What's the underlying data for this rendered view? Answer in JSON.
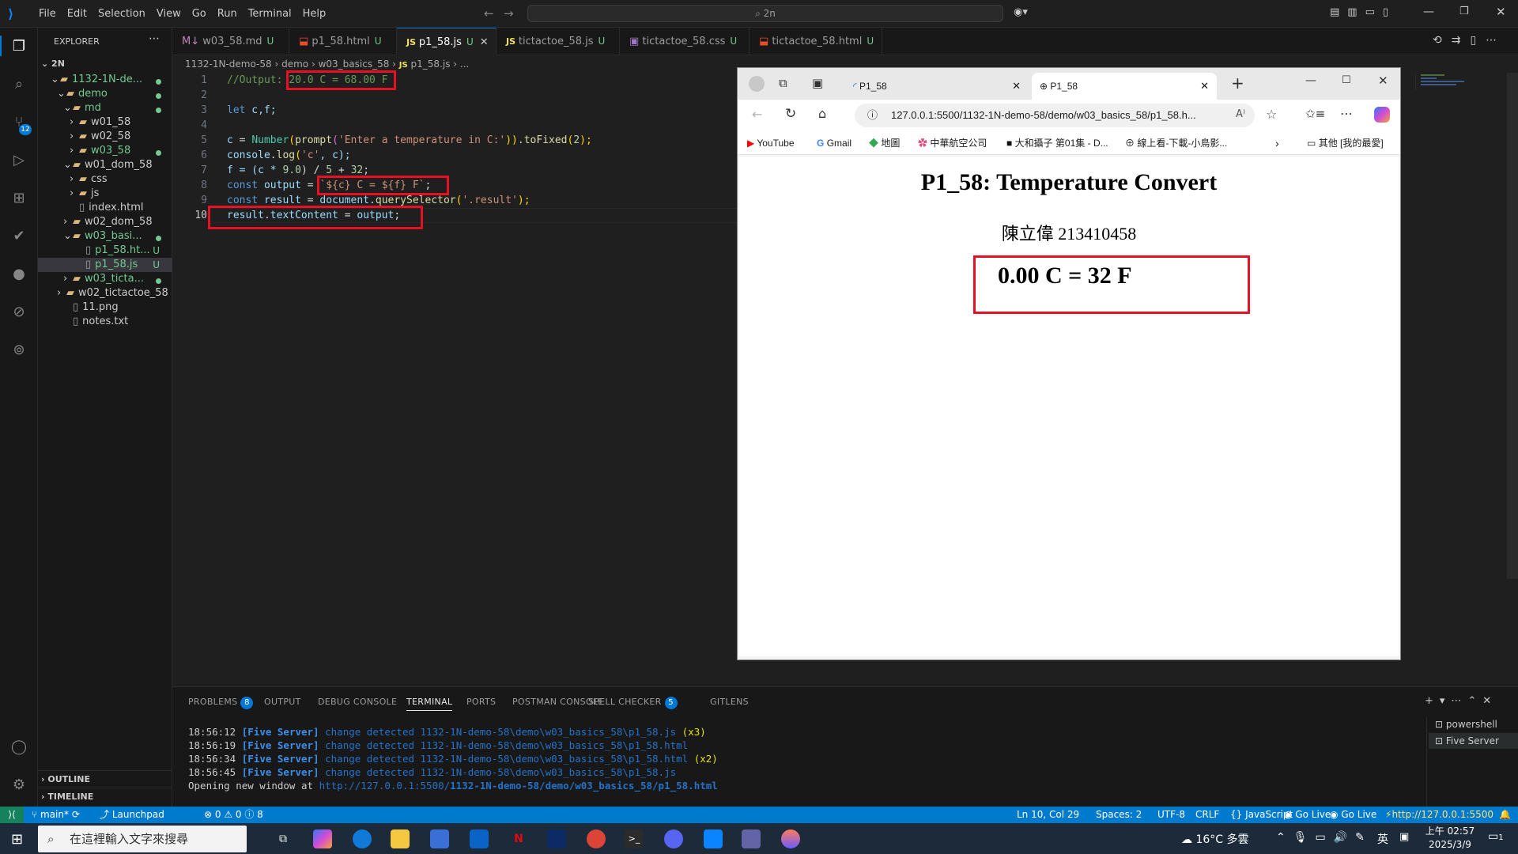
{
  "titlebar": {
    "menu": [
      "File",
      "Edit",
      "Selection",
      "View",
      "Go",
      "Run",
      "Terminal",
      "Help"
    ],
    "search": "2n"
  },
  "explorer": {
    "header": "EXPLORER",
    "root": "2N",
    "items": [
      {
        "label": "1132-1N-de...",
        "type": "folder",
        "mod": "dot"
      },
      {
        "label": "demo",
        "type": "folder",
        "mod": "dot"
      },
      {
        "label": "md",
        "type": "folder",
        "mod": "dot"
      },
      {
        "label": "w01_58",
        "type": "folder",
        "mod": ""
      },
      {
        "label": "w02_58",
        "type": "folder",
        "mod": ""
      },
      {
        "label": "w03_58",
        "type": "folder",
        "mod": "dot"
      },
      {
        "label": "w01_dom_58",
        "type": "folder",
        "mod": ""
      },
      {
        "label": "css",
        "type": "folder",
        "mod": ""
      },
      {
        "label": "js",
        "type": "folder",
        "mod": ""
      },
      {
        "label": "index.html",
        "type": "file",
        "mod": ""
      },
      {
        "label": "w02_dom_58",
        "type": "folder",
        "mod": ""
      },
      {
        "label": "w03_basi...",
        "type": "folder",
        "mod": "dot"
      },
      {
        "label": "p1_58.ht...",
        "type": "file",
        "mod": "U"
      },
      {
        "label": "p1_58.js",
        "type": "file",
        "mod": "U"
      },
      {
        "label": "w03_ticta...",
        "type": "folder",
        "mod": "dot"
      },
      {
        "label": "w02_tictactoe_58",
        "type": "folder",
        "mod": ""
      },
      {
        "label": "11.png",
        "type": "file",
        "mod": ""
      },
      {
        "label": "notes.txt",
        "type": "file",
        "mod": ""
      }
    ],
    "outline": "OUTLINE",
    "timeline": "TIMELINE"
  },
  "tabs": [
    {
      "label": "w03_58.md",
      "badge": "U"
    },
    {
      "label": "p1_58.html",
      "badge": "U"
    },
    {
      "label": "p1_58.js",
      "badge": "U"
    },
    {
      "label": "tictactoe_58.js",
      "badge": "U"
    },
    {
      "label": "tictactoe_58.css",
      "badge": "U"
    },
    {
      "label": "tictactoe_58.html",
      "badge": "U"
    }
  ],
  "breadcrumb": [
    "1132-1N-demo-58",
    "demo",
    "w03_basics_58",
    "p1_58.js",
    "..."
  ],
  "code": {
    "line_numbers": [
      "1",
      "2",
      "3",
      "4",
      "5",
      "6",
      "7",
      "8",
      "9",
      "10"
    ],
    "l1_comment": "//Output: ",
    "l1_highlight": "20.0 C = 68.00 F",
    "l3_kw": "let",
    "l3_vars": " c,f;",
    "l5": {
      "a": "c",
      "b": " = ",
      "c": "Number",
      "d": "(",
      "e": "prompt",
      "f": "(",
      "g": "'Enter a temperature in C:'",
      "h": "))",
      "i": ".",
      "j": "toFixed",
      "k": "(",
      "l": "2",
      "m": ");"
    },
    "l6": {
      "a": "console",
      "b": ".",
      "c": "log",
      "d": "(",
      "e": "'c'",
      "f": ", c);"
    },
    "l7": {
      "a": "f",
      "b": " = (c * ",
      "c": "9.0",
      "d": ") / ",
      "e": "5",
      "f": " + ",
      "g": "32",
      "h": ";"
    },
    "l8": {
      "a": "const",
      "b": " output",
      "c": " = ",
      "d": "`${c} C = ${f} F`",
      "e": ";"
    },
    "l9": {
      "a": "const",
      "b": " result",
      "c": " = ",
      "d": "document",
      "e": ".",
      "f": "querySelector",
      "g": "(",
      "h": "'.result'",
      "i": ");"
    },
    "l10": {
      "a": "result",
      "b": ".",
      "c": "textContent",
      "d": " = ",
      "e": "output",
      "f": ";"
    }
  },
  "browser": {
    "tab1": "P1_58",
    "tab2": "P1_58",
    "url": "127.0.0.1:5500/1132-1N-demo-58/demo/w03_basics_58/p1_58.h...",
    "bookmarks": [
      "YouTube",
      "Gmail",
      "地圖",
      "中華航空公司",
      "大和攝子 第01集 - D...",
      "線上看-下載-小鳥影...",
      "其他 [我的最愛]"
    ],
    "page": {
      "heading": "P1_58: Temperature Convert",
      "author": "陳立偉 213410458",
      "result": "0.00 C = 32 F"
    }
  },
  "panel": {
    "tabs": [
      {
        "label": "PROBLEMS",
        "badge": "8"
      },
      {
        "label": "OUTPUT",
        "badge": ""
      },
      {
        "label": "DEBUG CONSOLE",
        "badge": ""
      },
      {
        "label": "TERMINAL",
        "badge": ""
      },
      {
        "label": "PORTS",
        "badge": ""
      },
      {
        "label": "POSTMAN CONSOLE",
        "badge": ""
      },
      {
        "label": "SPELL CHECKER",
        "badge": "5"
      },
      {
        "label": "GITLENS",
        "badge": ""
      }
    ],
    "terminal": [
      {
        "time": "18:56:12",
        "tag": "[Five Server]",
        "msg": "change detected 1132-1N-demo-58\\demo\\w03_basics_58\\p1_58.js",
        "suffix": "(x3)"
      },
      {
        "time": "18:56:19",
        "tag": "[Five Server]",
        "msg": "change detected 1132-1N-demo-58\\demo\\w03_basics_58\\p1_58.html",
        "suffix": ""
      },
      {
        "time": "18:56:34",
        "tag": "[Five Server]",
        "msg": "change detected 1132-1N-demo-58\\demo\\w03_basics_58\\p1_58.html",
        "suffix": "(x2)"
      },
      {
        "time": "18:56:45",
        "tag": "[Five Server]",
        "msg": "change detected 1132-1N-demo-58\\demo\\w03_basics_58\\p1_58.js",
        "suffix": ""
      }
    ],
    "open_text": "Opening new window at ",
    "open_url_a": "http://127.0.0.1:5500/",
    "open_url_b": "1132-1N-demo-58/demo/w03_basics_58/p1_58.html",
    "terminals": [
      "powershell",
      "Five Server"
    ]
  },
  "statusbar": {
    "branch": "main*",
    "launchpad": "Launchpad",
    "problems": "0 ⚠ 0 ⓘ 8",
    "position": "Ln 10, Col 29",
    "spaces": "Spaces: 2",
    "encoding": "UTF-8",
    "eol": "CRLF",
    "language": "JavaScript",
    "golive1": "Go Live",
    "golive2": "Go Live",
    "server": "http://127.0.0.1:5500"
  },
  "taskbar": {
    "search": "在這裡輸入文字來搜尋",
    "weather": "16°C  多雲",
    "ime": "英",
    "time": "上午 02:57",
    "date": "2025/3/9",
    "notif": "1"
  }
}
